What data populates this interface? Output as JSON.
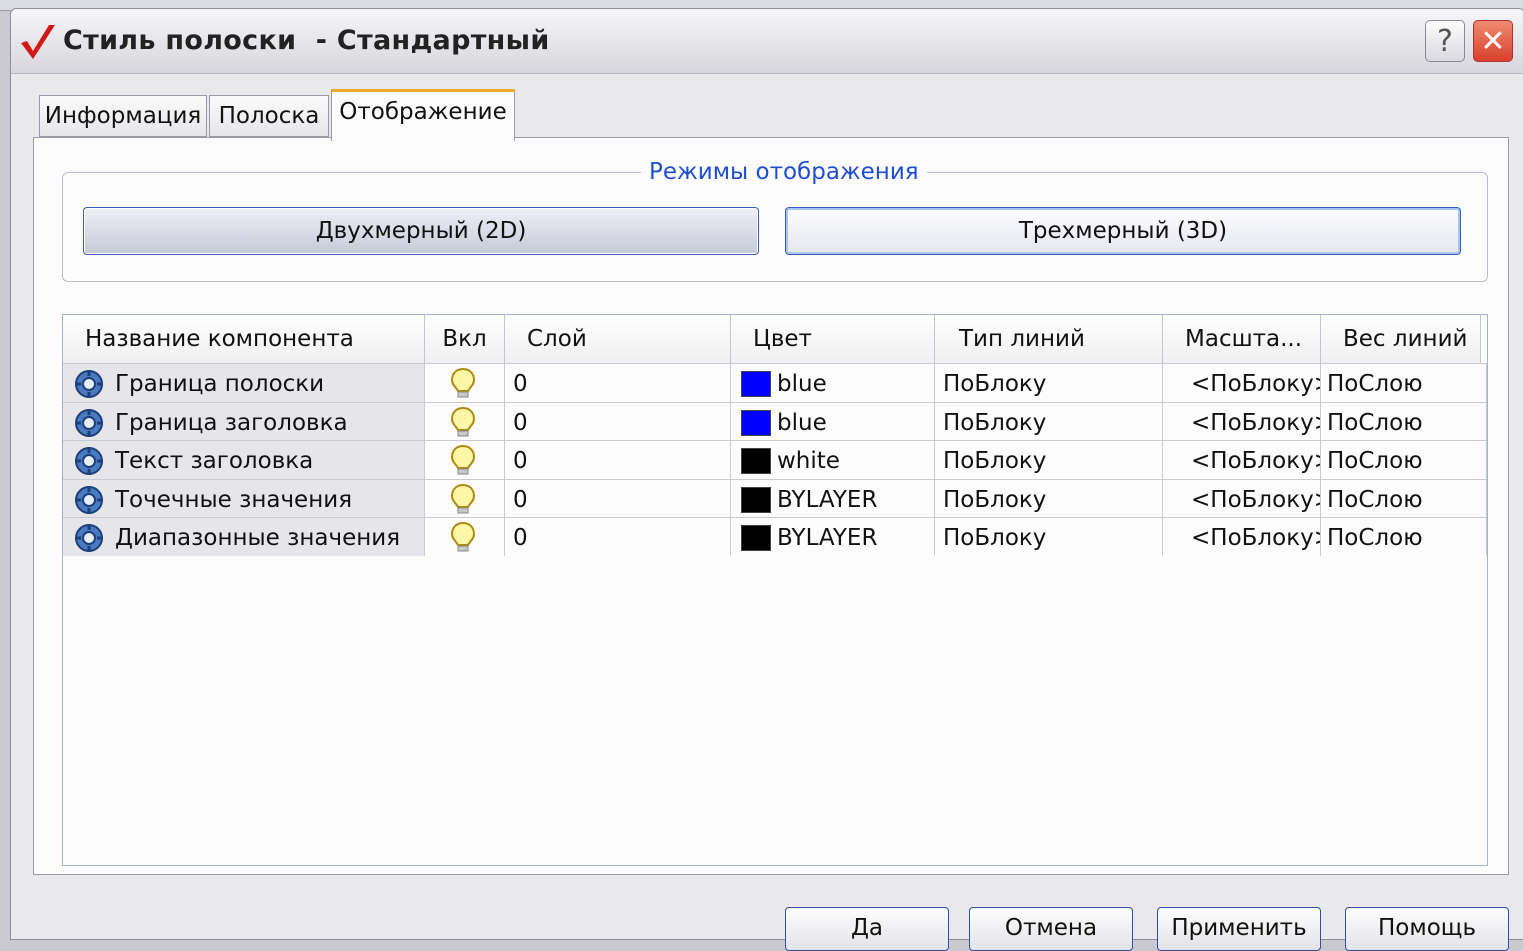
{
  "window": {
    "title": "Стиль полоски  - Стандартный",
    "help_label": "?",
    "close_label": "✕"
  },
  "tabs": [
    {
      "label": "Информация",
      "active": false
    },
    {
      "label": "Полоска",
      "active": false
    },
    {
      "label": "Отображение",
      "active": true
    }
  ],
  "display_modes": {
    "group_title": "Режимы отображения",
    "mode_2d": "Двухмерный (2D)",
    "mode_3d": "Трехмерный (3D)"
  },
  "table": {
    "headers": [
      "Название компонента",
      "Вкл",
      "Слой",
      "Цвет",
      "Тип линий",
      "Масшта...",
      "Вес линий"
    ],
    "rows": [
      {
        "name": "Граница полоски",
        "on": true,
        "layer": "0",
        "color_name": "blue",
        "color_hex": "#0000ff",
        "linetype": "ПоБлоку",
        "scale": "<ПоБлоку>",
        "lineweight": "ПоСлою"
      },
      {
        "name": "Граница заголовка",
        "on": true,
        "layer": "0",
        "color_name": "blue",
        "color_hex": "#0000ff",
        "linetype": "ПоБлоку",
        "scale": "<ПоБлоку>",
        "lineweight": "ПоСлою"
      },
      {
        "name": "Текст заголовка",
        "on": true,
        "layer": "0",
        "color_name": "white",
        "color_hex": "#000000",
        "linetype": "ПоБлоку",
        "scale": "<ПоБлоку>",
        "lineweight": "ПоСлою"
      },
      {
        "name": "Точечные значения",
        "on": true,
        "layer": "0",
        "color_name": "BYLAYER",
        "color_hex": "#000000",
        "linetype": "ПоБлоку",
        "scale": "<ПоБлоку>",
        "lineweight": "ПоСлою"
      },
      {
        "name": "Диапазонные значения",
        "on": true,
        "layer": "0",
        "color_name": "BYLAYER",
        "color_hex": "#000000",
        "linetype": "ПоБлоку",
        "scale": "<ПоБлоку>",
        "lineweight": "ПоСлою"
      }
    ]
  },
  "buttons": {
    "ok": "Да",
    "cancel": "Отмена",
    "apply": "Применить",
    "help": "Помощь"
  },
  "icons": {
    "app": "checkmark-icon",
    "component": "component-gear-icon",
    "visibility": "lightbulb-icon"
  },
  "colors": {
    "accent_tab": "#f0a82a",
    "group_title": "#1f4fd0",
    "close_button": "#d8402a"
  }
}
